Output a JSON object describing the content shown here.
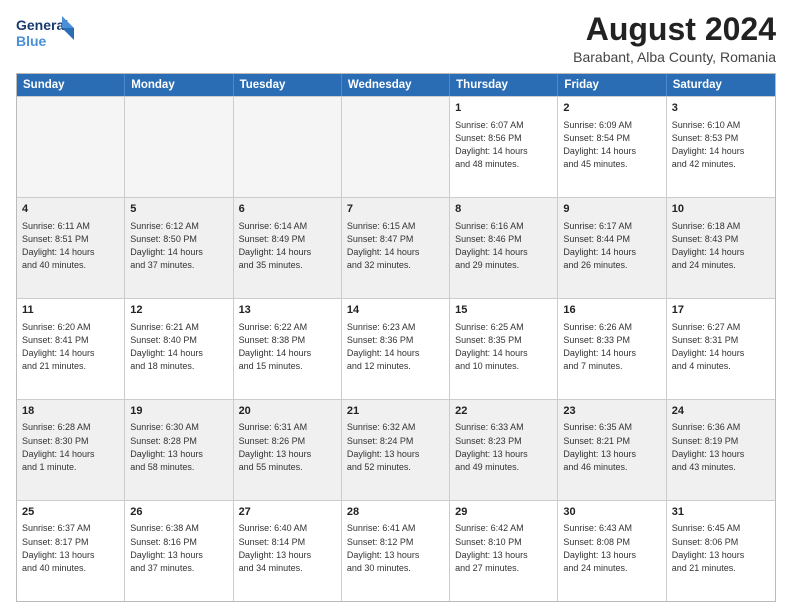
{
  "logo": {
    "line1": "General",
    "line2": "Blue"
  },
  "title": "August 2024",
  "subtitle": "Barabant, Alba County, Romania",
  "days": [
    "Sunday",
    "Monday",
    "Tuesday",
    "Wednesday",
    "Thursday",
    "Friday",
    "Saturday"
  ],
  "weeks": [
    [
      {
        "num": "",
        "empty": true
      },
      {
        "num": "",
        "empty": true
      },
      {
        "num": "",
        "empty": true
      },
      {
        "num": "",
        "empty": true
      },
      {
        "num": "1",
        "info": "Sunrise: 6:07 AM\nSunset: 8:56 PM\nDaylight: 14 hours\nand 48 minutes."
      },
      {
        "num": "2",
        "info": "Sunrise: 6:09 AM\nSunset: 8:54 PM\nDaylight: 14 hours\nand 45 minutes."
      },
      {
        "num": "3",
        "info": "Sunrise: 6:10 AM\nSunset: 8:53 PM\nDaylight: 14 hours\nand 42 minutes."
      }
    ],
    [
      {
        "num": "4",
        "info": "Sunrise: 6:11 AM\nSunset: 8:51 PM\nDaylight: 14 hours\nand 40 minutes.",
        "shaded": true
      },
      {
        "num": "5",
        "info": "Sunrise: 6:12 AM\nSunset: 8:50 PM\nDaylight: 14 hours\nand 37 minutes.",
        "shaded": true
      },
      {
        "num": "6",
        "info": "Sunrise: 6:14 AM\nSunset: 8:49 PM\nDaylight: 14 hours\nand 35 minutes.",
        "shaded": true
      },
      {
        "num": "7",
        "info": "Sunrise: 6:15 AM\nSunset: 8:47 PM\nDaylight: 14 hours\nand 32 minutes.",
        "shaded": true
      },
      {
        "num": "8",
        "info": "Sunrise: 6:16 AM\nSunset: 8:46 PM\nDaylight: 14 hours\nand 29 minutes.",
        "shaded": true
      },
      {
        "num": "9",
        "info": "Sunrise: 6:17 AM\nSunset: 8:44 PM\nDaylight: 14 hours\nand 26 minutes.",
        "shaded": true
      },
      {
        "num": "10",
        "info": "Sunrise: 6:18 AM\nSunset: 8:43 PM\nDaylight: 14 hours\nand 24 minutes.",
        "shaded": true
      }
    ],
    [
      {
        "num": "11",
        "info": "Sunrise: 6:20 AM\nSunset: 8:41 PM\nDaylight: 14 hours\nand 21 minutes."
      },
      {
        "num": "12",
        "info": "Sunrise: 6:21 AM\nSunset: 8:40 PM\nDaylight: 14 hours\nand 18 minutes."
      },
      {
        "num": "13",
        "info": "Sunrise: 6:22 AM\nSunset: 8:38 PM\nDaylight: 14 hours\nand 15 minutes."
      },
      {
        "num": "14",
        "info": "Sunrise: 6:23 AM\nSunset: 8:36 PM\nDaylight: 14 hours\nand 12 minutes."
      },
      {
        "num": "15",
        "info": "Sunrise: 6:25 AM\nSunset: 8:35 PM\nDaylight: 14 hours\nand 10 minutes."
      },
      {
        "num": "16",
        "info": "Sunrise: 6:26 AM\nSunset: 8:33 PM\nDaylight: 14 hours\nand 7 minutes."
      },
      {
        "num": "17",
        "info": "Sunrise: 6:27 AM\nSunset: 8:31 PM\nDaylight: 14 hours\nand 4 minutes."
      }
    ],
    [
      {
        "num": "18",
        "info": "Sunrise: 6:28 AM\nSunset: 8:30 PM\nDaylight: 14 hours\nand 1 minute.",
        "shaded": true
      },
      {
        "num": "19",
        "info": "Sunrise: 6:30 AM\nSunset: 8:28 PM\nDaylight: 13 hours\nand 58 minutes.",
        "shaded": true
      },
      {
        "num": "20",
        "info": "Sunrise: 6:31 AM\nSunset: 8:26 PM\nDaylight: 13 hours\nand 55 minutes.",
        "shaded": true
      },
      {
        "num": "21",
        "info": "Sunrise: 6:32 AM\nSunset: 8:24 PM\nDaylight: 13 hours\nand 52 minutes.",
        "shaded": true
      },
      {
        "num": "22",
        "info": "Sunrise: 6:33 AM\nSunset: 8:23 PM\nDaylight: 13 hours\nand 49 minutes.",
        "shaded": true
      },
      {
        "num": "23",
        "info": "Sunrise: 6:35 AM\nSunset: 8:21 PM\nDaylight: 13 hours\nand 46 minutes.",
        "shaded": true
      },
      {
        "num": "24",
        "info": "Sunrise: 6:36 AM\nSunset: 8:19 PM\nDaylight: 13 hours\nand 43 minutes.",
        "shaded": true
      }
    ],
    [
      {
        "num": "25",
        "info": "Sunrise: 6:37 AM\nSunset: 8:17 PM\nDaylight: 13 hours\nand 40 minutes."
      },
      {
        "num": "26",
        "info": "Sunrise: 6:38 AM\nSunset: 8:16 PM\nDaylight: 13 hours\nand 37 minutes."
      },
      {
        "num": "27",
        "info": "Sunrise: 6:40 AM\nSunset: 8:14 PM\nDaylight: 13 hours\nand 34 minutes."
      },
      {
        "num": "28",
        "info": "Sunrise: 6:41 AM\nSunset: 8:12 PM\nDaylight: 13 hours\nand 30 minutes."
      },
      {
        "num": "29",
        "info": "Sunrise: 6:42 AM\nSunset: 8:10 PM\nDaylight: 13 hours\nand 27 minutes."
      },
      {
        "num": "30",
        "info": "Sunrise: 6:43 AM\nSunset: 8:08 PM\nDaylight: 13 hours\nand 24 minutes."
      },
      {
        "num": "31",
        "info": "Sunrise: 6:45 AM\nSunset: 8:06 PM\nDaylight: 13 hours\nand 21 minutes."
      }
    ]
  ]
}
